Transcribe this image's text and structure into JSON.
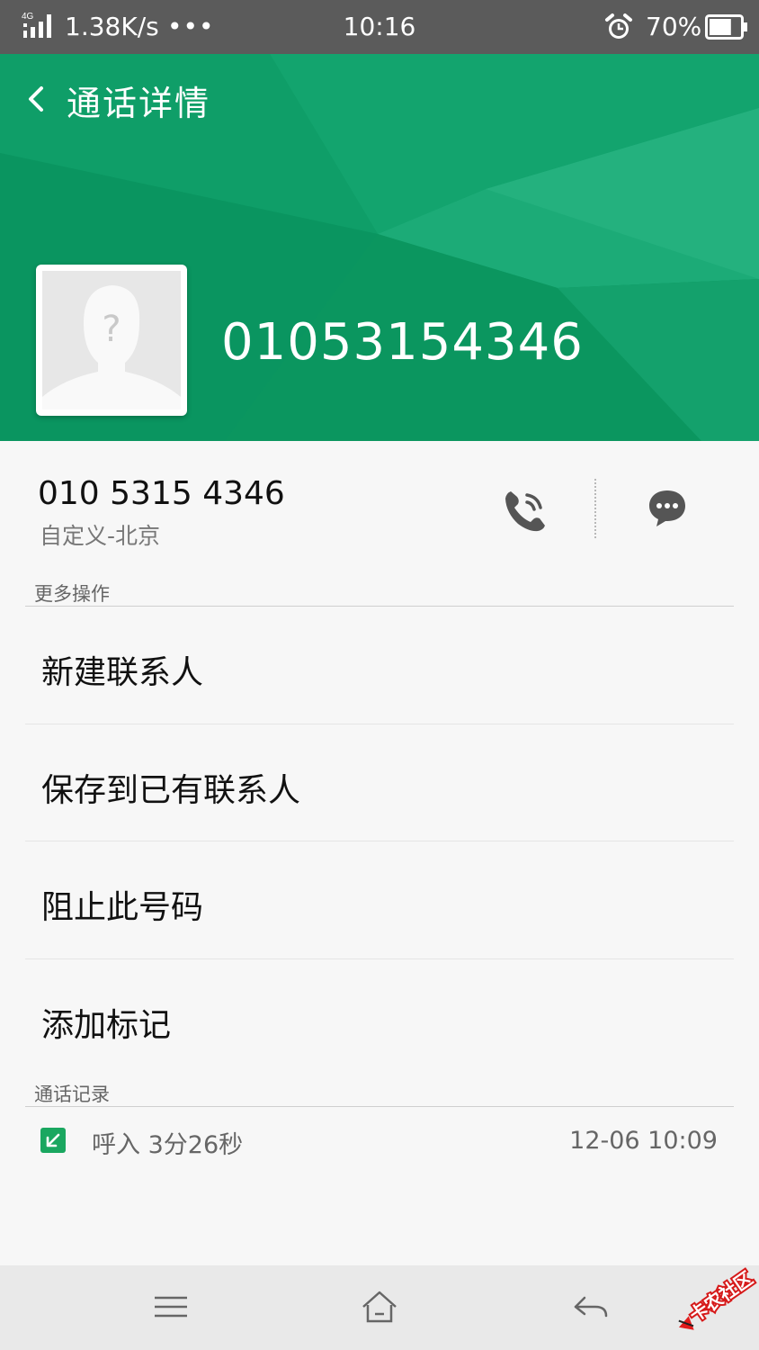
{
  "status_bar": {
    "network_type": "4G",
    "net_speed": "1.38K/s",
    "more_dots": "•••",
    "time": "10:16",
    "battery_percent": "70%",
    "battery_level": 0.7
  },
  "header": {
    "title": "通话详情",
    "number": "01053154346",
    "avatar_glyph": "?"
  },
  "contact": {
    "formatted_number": "010 5315 4346",
    "location": "自定义-北京"
  },
  "more_actions": {
    "label": "更多操作",
    "items": [
      {
        "label": "新建联系人"
      },
      {
        "label": "保存到已有联系人"
      },
      {
        "label": "阻止此号码"
      },
      {
        "label": "添加标记"
      }
    ]
  },
  "call_log": {
    "label": "通话记录",
    "entries": [
      {
        "type": "呼入",
        "duration": "3分26秒",
        "datetime": "12-06 10:09"
      }
    ]
  },
  "watermark": {
    "text": "卡农社区"
  },
  "colors": {
    "header_green": "#0d9b64",
    "call_in_icon": "#1aa760",
    "status_bar": "#5b5b5b"
  },
  "icons": [
    "signal-icon",
    "alarm-icon",
    "battery-icon",
    "back-arrow-icon",
    "phone-call-icon",
    "message-icon",
    "incoming-call-icon",
    "menu-icon",
    "home-icon",
    "back-icon"
  ]
}
